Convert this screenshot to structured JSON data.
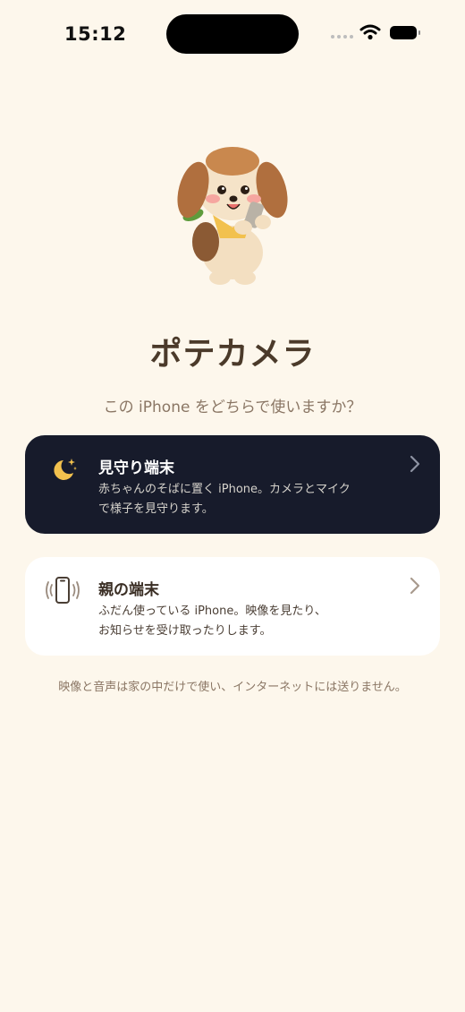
{
  "status_bar": {
    "time": "15:12",
    "icons": [
      "signal-dots-icon",
      "wifi-icon",
      "battery-icon"
    ]
  },
  "app": {
    "title": "ポテカメラ",
    "subtitle": "この iPhone をどちらで使いますか？",
    "mascot": "puppy-holding-phone-illustration"
  },
  "options": [
    {
      "id": "monitor",
      "title": "見守り端末",
      "description": "赤ちゃんのそばに置く iPhone。カメラとマイク\nで様子を見守ります。",
      "icon": "moon-stars-icon",
      "background": "#171B2B"
    },
    {
      "id": "parent",
      "title": "親の端末",
      "description": "ふだん使っている iPhone。映像を見たり、\nお知らせを受け取ったりします。",
      "icon": "phone-vibrate-icon",
      "background": "#FFFFFF"
    }
  ],
  "footnote": "映像と音声は家の中だけで使い、インターネットには送りません。",
  "colors": {
    "background": "#FDF7EC",
    "accent_gold": "#F2C14E",
    "text_brown": "#4B3A2A",
    "muted_brown": "#8A7664"
  }
}
